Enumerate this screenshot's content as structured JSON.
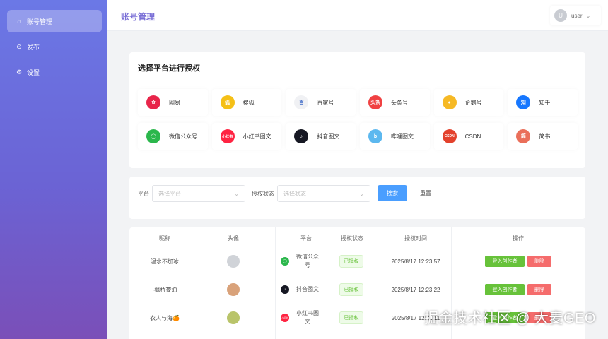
{
  "sidebar": {
    "items": [
      {
        "label": "账号管理",
        "icon": "home-icon",
        "active": true
      },
      {
        "label": "发布",
        "icon": "play-circle-icon",
        "active": false
      },
      {
        "label": "设置",
        "icon": "gear-icon",
        "active": false
      }
    ]
  },
  "header": {
    "title": "账号管理",
    "avatar_letter": "U",
    "user_name": "user"
  },
  "platform_section": {
    "title": "选择平台进行授权",
    "platforms": [
      {
        "name": "网易",
        "icon": "netease-icon",
        "color": "#e8254a",
        "mark": "✿"
      },
      {
        "name": "搜狐",
        "icon": "sohu-icon",
        "color": "#f5c017",
        "mark": "狐"
      },
      {
        "name": "百家号",
        "icon": "baijiahao-icon",
        "color": "#f0f1f4",
        "mark": "百"
      },
      {
        "name": "头条号",
        "icon": "toutiao-icon",
        "color": "#f04142",
        "mark": "头条"
      },
      {
        "name": "企鹅号",
        "icon": "qiehao-icon",
        "color": "#f6b925",
        "mark": "●"
      },
      {
        "name": "知乎",
        "icon": "zhihu-icon",
        "color": "#1677ff",
        "mark": "知"
      },
      {
        "name": "微信公众号",
        "icon": "wechat-icon",
        "color": "#2bb74c",
        "mark": "◯"
      },
      {
        "name": "小红书图文",
        "icon": "xiaohongshu-icon",
        "color": "#ff2442",
        "mark": "小红书"
      },
      {
        "name": "抖音图文",
        "icon": "douyin-icon",
        "color": "#161823",
        "mark": "♪"
      },
      {
        "name": "哔哩图文",
        "icon": "bilibili-icon",
        "color": "#5cb8ef",
        "mark": "b"
      },
      {
        "name": "CSDN",
        "icon": "csdn-icon",
        "color": "#e3412c",
        "mark": "CSDN"
      },
      {
        "name": "简书",
        "icon": "jianshu-icon",
        "color": "#ea6f5a",
        "mark": "简"
      }
    ]
  },
  "filters": {
    "platform_label": "平台",
    "platform_placeholder": "选择平台",
    "status_label": "授权状态",
    "status_placeholder": "选择状态",
    "search_label": "搜索",
    "reset_label": "重置"
  },
  "table": {
    "headers": [
      "昵称",
      "头像",
      "平台",
      "授权状态",
      "授权时间",
      "操作"
    ],
    "rows": [
      {
        "nickname": "温水不加冰",
        "avatar_color": "#d0d3d8",
        "platform": "微信公众号",
        "platform_color": "#2bb74c",
        "platform_mark": "◯",
        "status": "已授权",
        "time": "2025/8/17 12:23:57",
        "enter_label": "登入创作者",
        "delete_label": "删除"
      },
      {
        "nickname": "-枫桥夜泊",
        "avatar_color": "#d9a27a",
        "platform": "抖音图文",
        "platform_color": "#161823",
        "platform_mark": "♪",
        "status": "已授权",
        "time": "2025/8/17 12:23:22",
        "enter_label": "登入创作者",
        "delete_label": "删除"
      },
      {
        "nickname": "衣人与海🍊",
        "avatar_color": "#b9c46a",
        "platform": "小红书图文",
        "platform_color": "#ff2442",
        "platform_mark": "小红书",
        "status": "已授权",
        "time": "2025/8/17 12:23:11",
        "enter_label": "登入创作者",
        "delete_label": "删除"
      }
    ]
  },
  "watermark": "掘金技术社区 @ 大麦GEO"
}
